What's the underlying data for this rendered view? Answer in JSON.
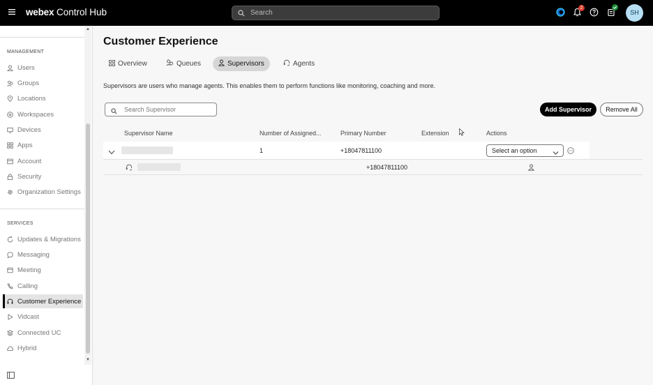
{
  "topbar": {
    "brand_bold": "webex",
    "brand_rest": " Control Hub",
    "search_placeholder": "Search",
    "notification_count": "2",
    "avatar_initials": "SH"
  },
  "sidebar": {
    "management_heading": "MANAGEMENT",
    "management_items": [
      {
        "label": "Users",
        "icon": "user-icon"
      },
      {
        "label": "Groups",
        "icon": "groups-icon"
      },
      {
        "label": "Locations",
        "icon": "location-pin-icon"
      },
      {
        "label": "Workspaces",
        "icon": "workspace-icon"
      },
      {
        "label": "Devices",
        "icon": "device-icon"
      },
      {
        "label": "Apps",
        "icon": "apps-icon"
      },
      {
        "label": "Account",
        "icon": "account-icon"
      },
      {
        "label": "Security",
        "icon": "lock-icon"
      },
      {
        "label": "Organization Settings",
        "icon": "gear-icon"
      }
    ],
    "services_heading": "SERVICES",
    "services_items": [
      {
        "label": "Updates & Migrations",
        "icon": "refresh-icon"
      },
      {
        "label": "Messaging",
        "icon": "chat-icon"
      },
      {
        "label": "Meeting",
        "icon": "meeting-icon"
      },
      {
        "label": "Calling",
        "icon": "phone-icon"
      },
      {
        "label": "Customer Experience",
        "icon": "customer-experience-icon",
        "active": true
      },
      {
        "label": "Vidcast",
        "icon": "play-icon"
      },
      {
        "label": "Connected UC",
        "icon": "stack-icon"
      },
      {
        "label": "Hybrid",
        "icon": "cloud-icon"
      }
    ]
  },
  "main": {
    "title": "Customer Experience",
    "tabs": [
      {
        "label": "Overview",
        "icon": "grid-icon"
      },
      {
        "label": "Queues",
        "icon": "queues-icon"
      },
      {
        "label": "Supervisors",
        "icon": "supervisor-icon",
        "active": true
      },
      {
        "label": "Agents",
        "icon": "headset-icon"
      }
    ],
    "description": "Supervisors are users who manage agents. This enables them to perform functions like monitoring, coaching and more.",
    "search_placeholder": "Search Supervisor",
    "add_button": "Add Supervisor",
    "remove_button": "Remove All",
    "columns": [
      "Supervisor Name",
      "Number of Assigned...",
      "Primary Number",
      "Extension",
      "Actions"
    ],
    "rows": [
      {
        "assigned": "1",
        "primary": "+18047811100",
        "action_select": "Select an option"
      }
    ],
    "sub_rows": [
      {
        "primary": "+18047811100"
      }
    ]
  },
  "colors": {
    "topbar": "#000000",
    "accent_black": "#000000",
    "notification_badge": "#d93829",
    "status_badge": "#1d8c3a"
  }
}
